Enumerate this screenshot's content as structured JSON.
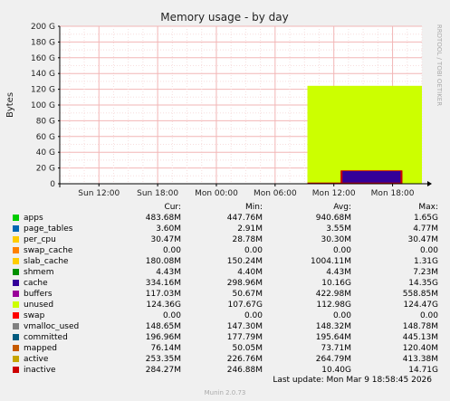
{
  "chart_data": {
    "type": "area",
    "title": "Memory usage - by day",
    "ylabel": "Bytes",
    "ylim": [
      0,
      200
    ],
    "yticks": [
      0,
      20,
      40,
      60,
      80,
      100,
      120,
      140,
      160,
      180,
      200
    ],
    "ytick_labels": [
      "0",
      "20 G",
      "40 G",
      "60 G",
      "80 G",
      "100 G",
      "120 G",
      "140 G",
      "160 G",
      "180 G",
      "200 G"
    ],
    "xtick_labels": [
      "Sun 12:00",
      "Sun 18:00",
      "Mon 00:00",
      "Mon 06:00",
      "Mon 12:00",
      "Mon 18:00"
    ],
    "x_hours": [
      0,
      6,
      12,
      18,
      24,
      30
    ],
    "xlim_hours": [
      -4,
      33
    ],
    "grid": true,
    "bands": [
      {
        "series": "unused",
        "hours": [
          21.3,
          33.0
        ],
        "top": 124.36,
        "color": "#ccff00"
      },
      {
        "series": "cache",
        "hours": [
          24.7,
          31.0
        ],
        "top": 16,
        "bottom": 1.5,
        "color": "#330099"
      },
      {
        "series": "inactive",
        "hours": [
          21.3,
          31.0
        ],
        "top": 1.5,
        "color": "#cc0000"
      },
      {
        "series": "inactive",
        "hours": [
          24.7,
          31.0
        ],
        "top": 17,
        "color": "#cc0000"
      }
    ]
  },
  "side_text": "RRDTOOL / TOBI OETIKER",
  "legend": {
    "headers": [
      "Cur:",
      "Min:",
      "Avg:",
      "Max:"
    ],
    "rows": [
      {
        "name": "apps",
        "color": "#00cc00",
        "cur": "483.68M",
        "min": "447.76M",
        "avg": "940.68M",
        "max": "1.65G"
      },
      {
        "name": "page_tables",
        "color": "#0066b3",
        "cur": "3.60M",
        "min": "2.91M",
        "avg": "3.55M",
        "max": "4.77M"
      },
      {
        "name": "per_cpu",
        "color": "#ffcc00",
        "cur": "30.47M",
        "min": "28.78M",
        "avg": "30.30M",
        "max": "30.47M"
      },
      {
        "name": "swap_cache",
        "color": "#ff8000",
        "cur": "0.00",
        "min": "0.00",
        "avg": "0.00",
        "max": "0.00"
      },
      {
        "name": "slab_cache",
        "color": "#ffcc00",
        "cur": "180.08M",
        "min": "150.24M",
        "avg": "1004.11M",
        "max": "1.31G"
      },
      {
        "name": "shmem",
        "color": "#008f00",
        "cur": "4.43M",
        "min": "4.40M",
        "avg": "4.43M",
        "max": "7.23M"
      },
      {
        "name": "cache",
        "color": "#330099",
        "cur": "334.16M",
        "min": "298.96M",
        "avg": "10.16G",
        "max": "14.35G"
      },
      {
        "name": "buffers",
        "color": "#990099",
        "cur": "117.03M",
        "min": "50.67M",
        "avg": "422.98M",
        "max": "558.85M"
      },
      {
        "name": "unused",
        "color": "#ccff00",
        "cur": "124.36G",
        "min": "107.67G",
        "avg": "112.98G",
        "max": "124.47G"
      },
      {
        "name": "swap",
        "color": "#ff0000",
        "cur": "0.00",
        "min": "0.00",
        "avg": "0.00",
        "max": "0.00"
      },
      {
        "name": "vmalloc_used",
        "color": "#808080",
        "cur": "148.65M",
        "min": "147.30M",
        "avg": "148.32M",
        "max": "148.78M"
      },
      {
        "name": "committed",
        "color": "#005b7f",
        "cur": "196.96M",
        "min": "177.79M",
        "avg": "195.64M",
        "max": "445.13M"
      },
      {
        "name": "mapped",
        "color": "#c65a00",
        "cur": "76.14M",
        "min": "50.05M",
        "avg": "73.71M",
        "max": "120.40M"
      },
      {
        "name": "active",
        "color": "#c6a500",
        "cur": "253.35M",
        "min": "226.76M",
        "avg": "264.79M",
        "max": "413.38M"
      },
      {
        "name": "inactive",
        "color": "#cc0000",
        "cur": "284.27M",
        "min": "246.88M",
        "avg": "10.40G",
        "max": "14.71G"
      }
    ]
  },
  "footer": "Last update: Mon Mar  9 18:58:45 2026",
  "munin": "Munin 2.0.73"
}
